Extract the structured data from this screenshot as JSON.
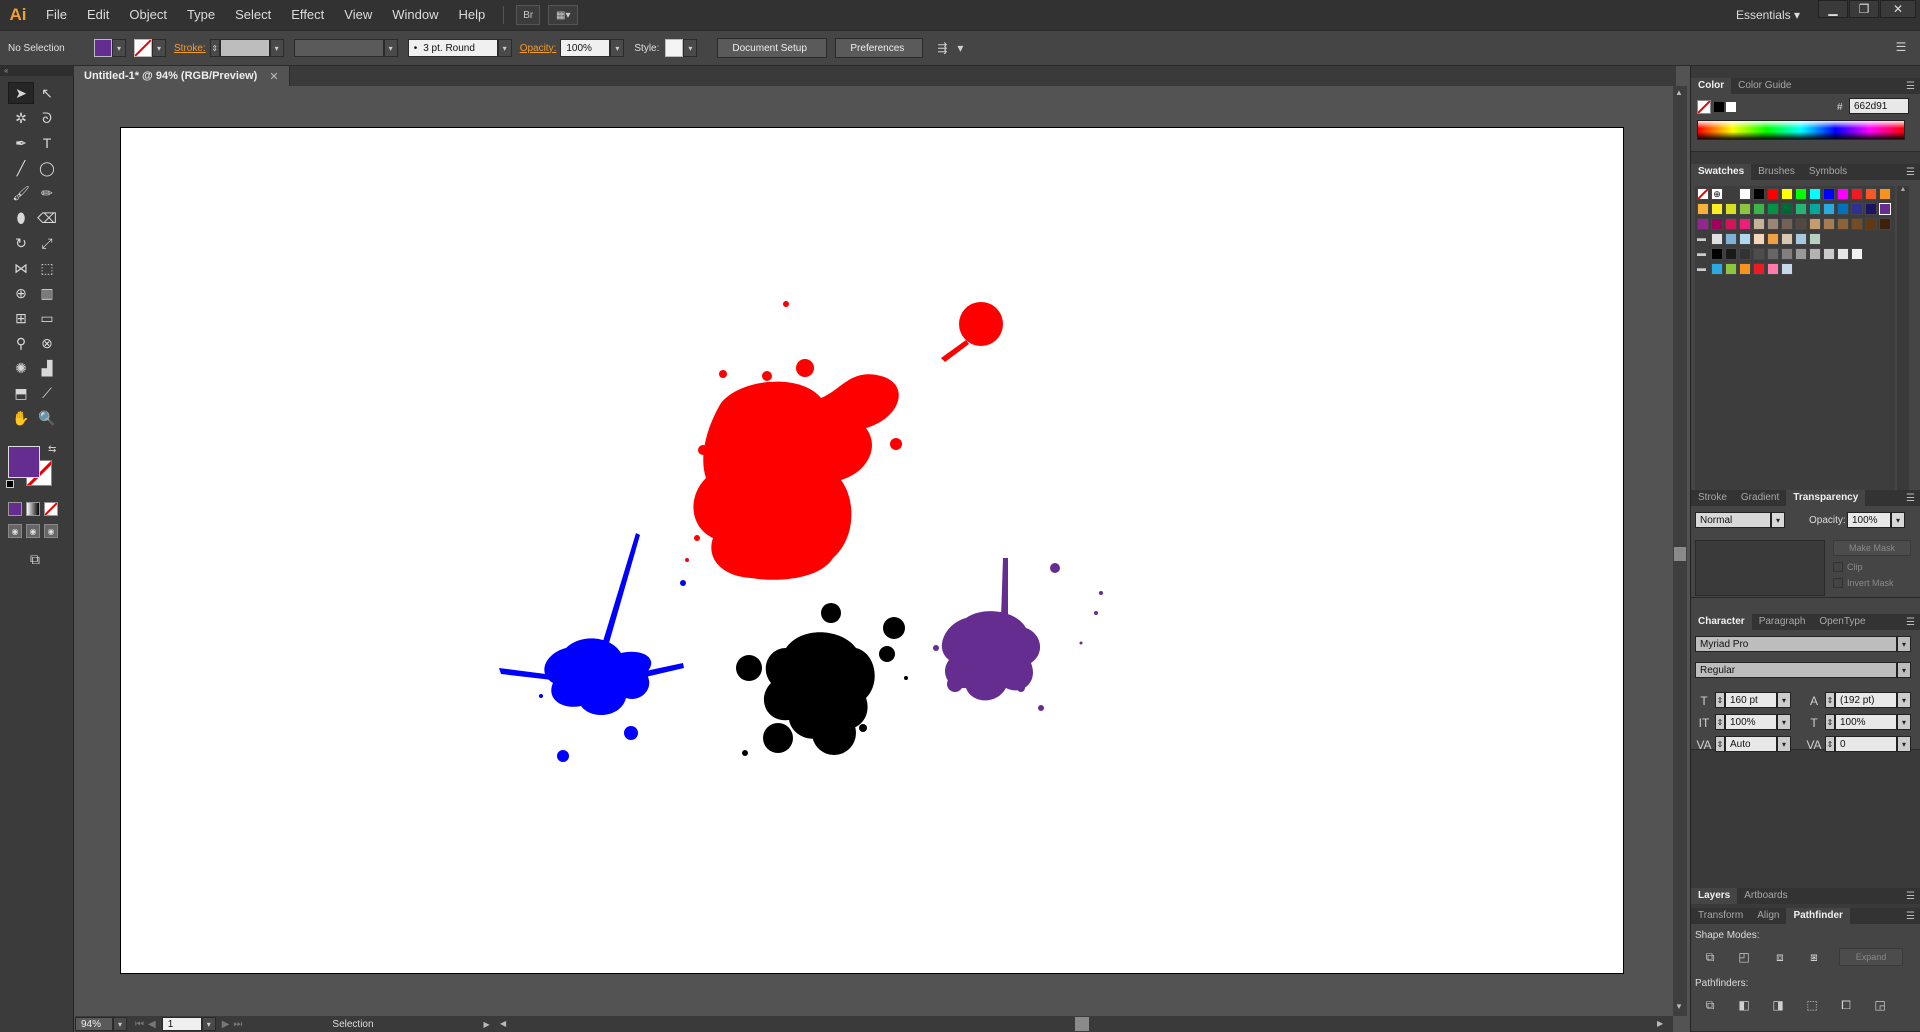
{
  "app": {
    "logo": "Ai",
    "workspace": "Essentials",
    "window_min": "▁",
    "window_max": "❐",
    "window_close": "✕"
  },
  "menu": [
    "File",
    "Edit",
    "Object",
    "Type",
    "Select",
    "Effect",
    "View",
    "Window",
    "Help"
  ],
  "menubar_buttons": [
    "Br",
    "▦▾"
  ],
  "control": {
    "selection": "No Selection",
    "fill_color": "#662d91",
    "stroke_label": "Stroke:",
    "brush": "3 pt. Round",
    "opacity_label": "Opacity:",
    "opacity": "100%",
    "style_label": "Style:",
    "document_setup": "Document Setup",
    "preferences": "Preferences"
  },
  "document": {
    "tab_title": "Untitled-1* @ 94% (RGB/Preview)",
    "close": "✕"
  },
  "status": {
    "zoom": "94%",
    "artboard": "1",
    "tool": "Selection"
  },
  "tools": [
    {
      "name": "selection-tool",
      "glyph": "➤"
    },
    {
      "name": "direct-selection-tool",
      "glyph": "↖"
    },
    {
      "name": "magic-wand-tool",
      "glyph": "✲"
    },
    {
      "name": "lasso-tool",
      "glyph": "ᘐ"
    },
    {
      "name": "pen-tool",
      "glyph": "✒"
    },
    {
      "name": "type-tool",
      "glyph": "T"
    },
    {
      "name": "line-segment-tool",
      "glyph": "╱"
    },
    {
      "name": "ellipse-tool",
      "glyph": "◯"
    },
    {
      "name": "paintbrush-tool",
      "glyph": "🖌"
    },
    {
      "name": "pencil-tool",
      "glyph": "✏"
    },
    {
      "name": "blob-brush-tool",
      "glyph": "⬮"
    },
    {
      "name": "eraser-tool",
      "glyph": "⌫"
    },
    {
      "name": "rotate-tool",
      "glyph": "↻"
    },
    {
      "name": "scale-tool",
      "glyph": "⤢"
    },
    {
      "name": "width-tool",
      "glyph": "⋈"
    },
    {
      "name": "free-transform-tool",
      "glyph": "⬚"
    },
    {
      "name": "shape-builder-tool",
      "glyph": "⊕"
    },
    {
      "name": "perspective-grid-tool",
      "glyph": "▥"
    },
    {
      "name": "mesh-tool",
      "glyph": "⊞"
    },
    {
      "name": "gradient-tool",
      "glyph": "▭"
    },
    {
      "name": "eyedropper-tool",
      "glyph": "⚲"
    },
    {
      "name": "blend-tool",
      "glyph": "⊗"
    },
    {
      "name": "symbol-sprayer-tool",
      "glyph": "✺"
    },
    {
      "name": "column-graph-tool",
      "glyph": "▟"
    },
    {
      "name": "artboard-tool",
      "glyph": "⬒"
    },
    {
      "name": "slice-tool",
      "glyph": "⟋"
    },
    {
      "name": "hand-tool",
      "glyph": "✋"
    },
    {
      "name": "zoom-tool",
      "glyph": "🔍"
    }
  ],
  "color_panel": {
    "tabs": [
      "Color",
      "Color Guide"
    ],
    "hex_label": "#",
    "hex": "662d91"
  },
  "swatches_panel": {
    "tabs": [
      "Swatches",
      "Brushes",
      "Symbols"
    ],
    "rows": [
      [
        "#ffffff",
        "#000000",
        "#ff0000",
        "#ffff00",
        "#00ff00",
        "#00ffff",
        "#0000ff",
        "#ff00ff",
        "#ed1c24",
        "#f15a24",
        "#f7931e"
      ],
      [
        "#fbb03b",
        "#fcee21",
        "#d9e021",
        "#8cc63f",
        "#39b54a",
        "#009245",
        "#006837",
        "#22b573",
        "#00a99d",
        "#29abe2",
        "#0071bc",
        "#2e3192",
        "#1b1464",
        "#662d91"
      ],
      [
        "#93278f",
        "#9e005d",
        "#d4145a",
        "#ed1e79",
        "#c7b299",
        "#998675",
        "#736357",
        "#534741",
        "#c69c6d",
        "#a67c52",
        "#8c6239",
        "#754c24",
        "#603813",
        "#42210b"
      ],
      [
        "#e0e0e0",
        "#7fb2d9",
        "#b0d9f0",
        "#f6d6b8",
        "#f0a040",
        "#d9c8b0",
        "#a8c8e0",
        "#b8d0c0"
      ],
      [
        "#000000",
        "#1a1a1a",
        "#333333",
        "#4d4d4d",
        "#666666",
        "#808080",
        "#999999",
        "#b3b3b3",
        "#cccccc",
        "#e6e6e6",
        "#f2f2f2"
      ],
      [
        "#29abe2",
        "#8cc63f",
        "#f7931e",
        "#ed1c24",
        "#ff7bac",
        "#c8d8e8"
      ]
    ]
  },
  "transparency_panel": {
    "tabs": [
      "Stroke",
      "Gradient",
      "Transparency"
    ],
    "mode": "Normal",
    "opacity_label": "Opacity:",
    "opacity": "100%",
    "make_mask": "Make Mask",
    "clip": "Clip",
    "invert_mask": "Invert Mask"
  },
  "character_panel": {
    "tabs": [
      "Character",
      "Paragraph",
      "OpenType"
    ],
    "font": "Myriad Pro",
    "style": "Regular",
    "size": "160 pt",
    "leading": "(192 pt)",
    "vscale": "100%",
    "hscale": "100%",
    "kerning": "Auto",
    "tracking": "0"
  },
  "layers_panel": {
    "tabs": [
      "Layers",
      "Artboards"
    ]
  },
  "pathfinder_panel": {
    "tabs": [
      "Transform",
      "Align",
      "Pathfinder"
    ],
    "shape_modes": "Shape Modes:",
    "expand": "Expand",
    "pathfinders": "Pathfinders:"
  },
  "colors": {
    "red_splat": "#ff0000",
    "blue_splat": "#0000ff",
    "black_splat": "#000000",
    "purple_splat": "#662d91"
  }
}
